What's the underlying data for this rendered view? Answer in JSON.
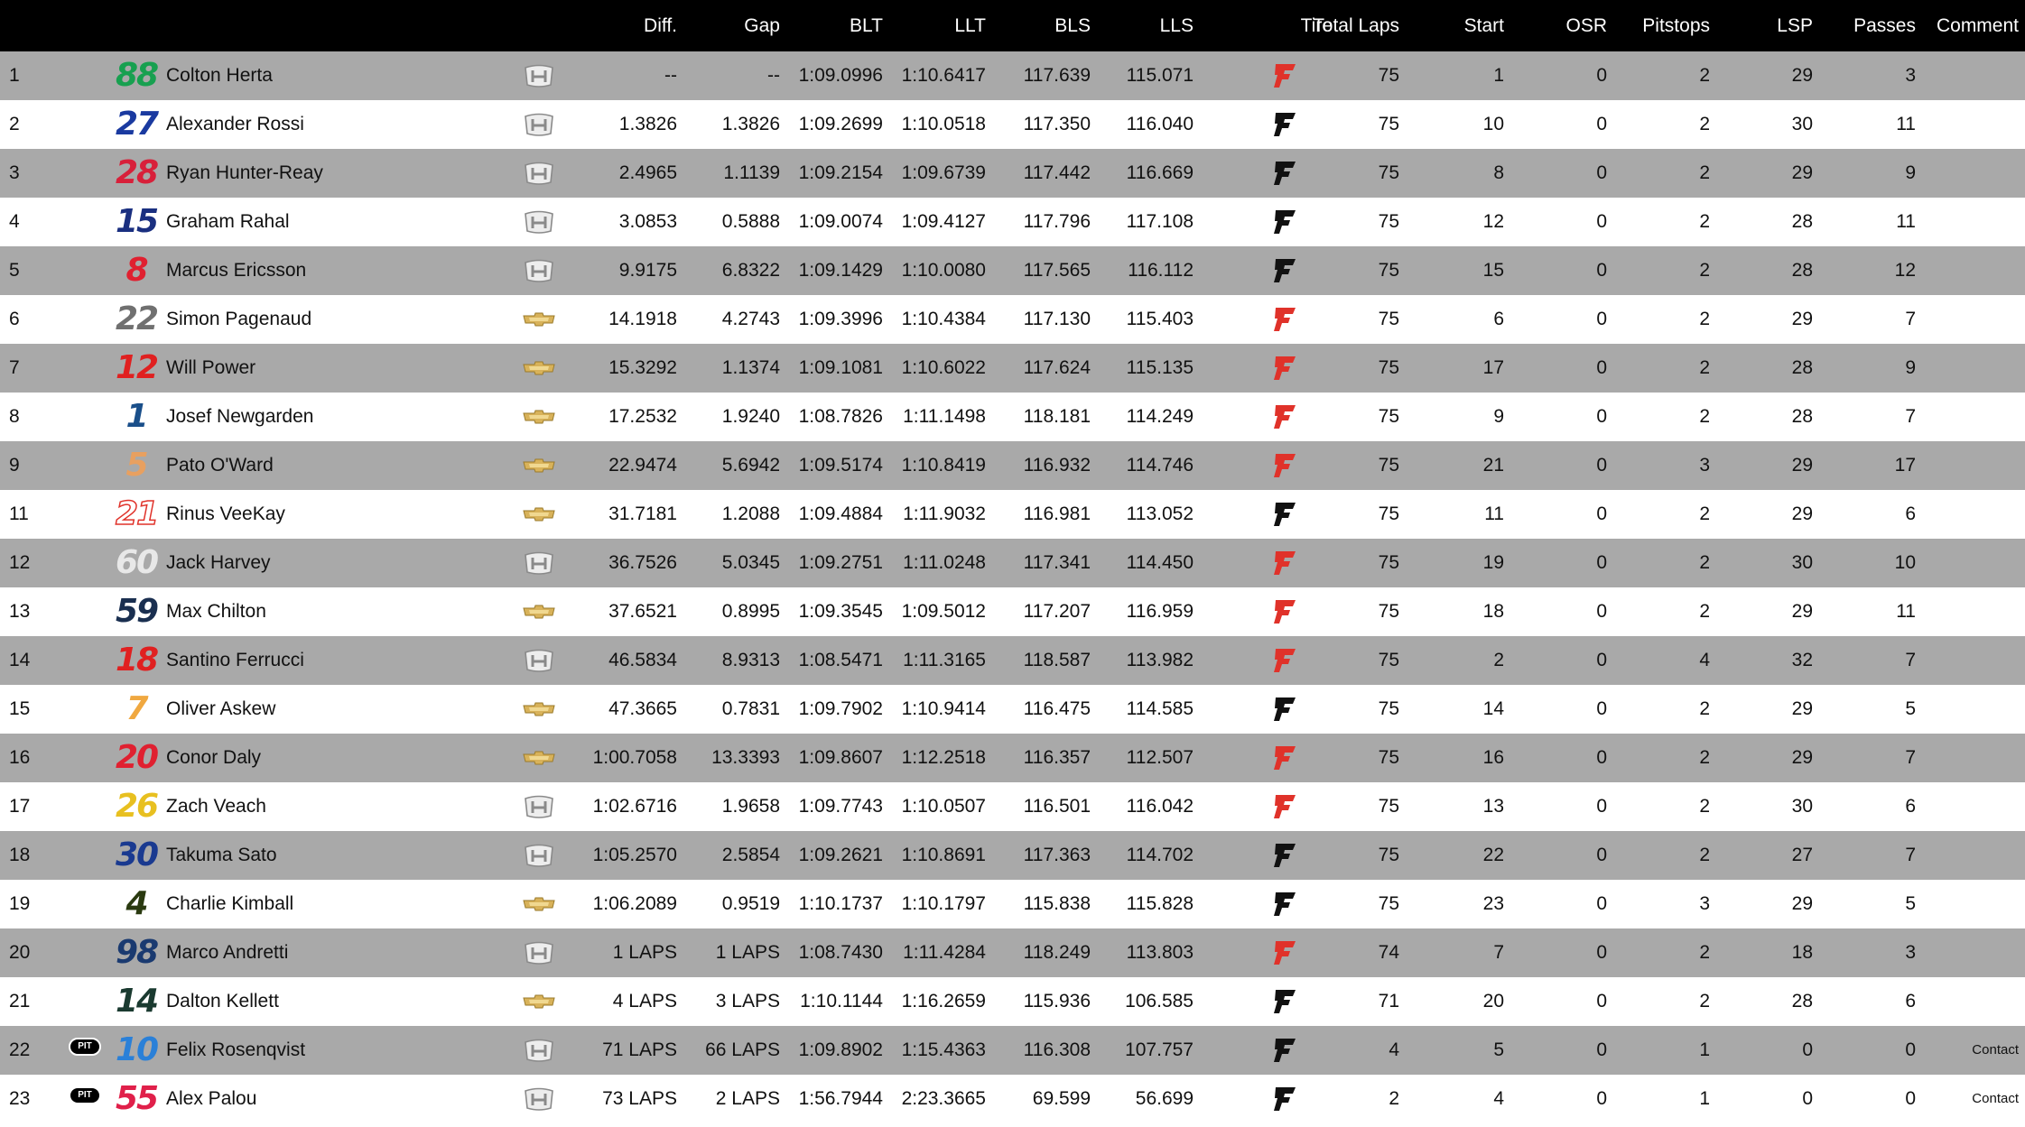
{
  "columns": {
    "diff": "Diff.",
    "gap": "Gap",
    "blt": "BLT",
    "llt": "LLT",
    "bls": "BLS",
    "lls": "LLS",
    "tire": "Tire",
    "total_laps": "Total Laps",
    "start": "Start",
    "osr": "OSR",
    "pitstops": "Pitstops",
    "lsp": "LSP",
    "passes": "Passes",
    "comment": "Comment"
  },
  "colors": {
    "header_bg": "#000000",
    "row_gray": "#a9a9a9",
    "row_white": "#ffffff",
    "tire_red": "#e0322a",
    "tire_black": "#111111"
  },
  "rows": [
    {
      "pos": "1",
      "pit": "",
      "num": "88",
      "num_color": "#18a050",
      "num_style": "solid",
      "name": "Colton Herta",
      "engine": "honda",
      "diff": "--",
      "gap": "--",
      "blt": "1:09.0996",
      "llt": "1:10.6417",
      "bls": "117.639",
      "lls": "115.071",
      "tire": "red",
      "laps": "75",
      "start": "1",
      "osr": "0",
      "pits": "2",
      "lsp": "29",
      "passes": "3",
      "comment": ""
    },
    {
      "pos": "2",
      "pit": "",
      "num": "27",
      "num_color": "#1a3aa0",
      "num_style": "solid",
      "name": "Alexander Rossi",
      "engine": "honda",
      "diff": "1.3826",
      "gap": "1.3826",
      "blt": "1:09.2699",
      "llt": "1:10.0518",
      "bls": "117.350",
      "lls": "116.040",
      "tire": "black",
      "laps": "75",
      "start": "10",
      "osr": "0",
      "pits": "2",
      "lsp": "30",
      "passes": "11",
      "comment": ""
    },
    {
      "pos": "3",
      "pit": "",
      "num": "28",
      "num_color": "#d8203a",
      "num_style": "solid",
      "name": "Ryan Hunter-Reay",
      "engine": "honda",
      "diff": "2.4965",
      "gap": "1.1139",
      "blt": "1:09.2154",
      "llt": "1:09.6739",
      "bls": "117.442",
      "lls": "116.669",
      "tire": "black",
      "laps": "75",
      "start": "8",
      "osr": "0",
      "pits": "2",
      "lsp": "29",
      "passes": "9",
      "comment": ""
    },
    {
      "pos": "4",
      "pit": "",
      "num": "15",
      "num_color": "#1a2f80",
      "num_style": "solid",
      "name": "Graham Rahal",
      "engine": "honda",
      "diff": "3.0853",
      "gap": "0.5888",
      "blt": "1:09.0074",
      "llt": "1:09.4127",
      "bls": "117.796",
      "lls": "117.108",
      "tire": "black",
      "laps": "75",
      "start": "12",
      "osr": "0",
      "pits": "2",
      "lsp": "28",
      "passes": "11",
      "comment": ""
    },
    {
      "pos": "5",
      "pit": "",
      "num": "8",
      "num_color": "#e02030",
      "num_style": "solid",
      "name": "Marcus Ericsson",
      "engine": "honda",
      "diff": "9.9175",
      "gap": "6.8322",
      "blt": "1:09.1429",
      "llt": "1:10.0080",
      "bls": "117.565",
      "lls": "116.112",
      "tire": "black",
      "laps": "75",
      "start": "15",
      "osr": "0",
      "pits": "2",
      "lsp": "28",
      "passes": "12",
      "comment": ""
    },
    {
      "pos": "6",
      "pit": "",
      "num": "22",
      "num_color": "#707070",
      "num_style": "solid",
      "name": "Simon Pagenaud",
      "engine": "chevrolet",
      "diff": "14.1918",
      "gap": "4.2743",
      "blt": "1:09.3996",
      "llt": "1:10.4384",
      "bls": "117.130",
      "lls": "115.403",
      "tire": "red",
      "laps": "75",
      "start": "6",
      "osr": "0",
      "pits": "2",
      "lsp": "29",
      "passes": "7",
      "comment": ""
    },
    {
      "pos": "7",
      "pit": "",
      "num": "12",
      "num_color": "#e02020",
      "num_style": "solid",
      "name": "Will Power",
      "engine": "chevrolet",
      "diff": "15.3292",
      "gap": "1.1374",
      "blt": "1:09.1081",
      "llt": "1:10.6022",
      "bls": "117.624",
      "lls": "115.135",
      "tire": "red",
      "laps": "75",
      "start": "17",
      "osr": "0",
      "pits": "2",
      "lsp": "28",
      "passes": "9",
      "comment": ""
    },
    {
      "pos": "8",
      "pit": "",
      "num": "1",
      "num_color": "#1a4f8a",
      "num_style": "solid",
      "name": "Josef Newgarden",
      "engine": "chevrolet",
      "diff": "17.2532",
      "gap": "1.9240",
      "blt": "1:08.7826",
      "llt": "1:11.1498",
      "bls": "118.181",
      "lls": "114.249",
      "tire": "red",
      "laps": "75",
      "start": "9",
      "osr": "0",
      "pits": "2",
      "lsp": "28",
      "passes": "7",
      "comment": ""
    },
    {
      "pos": "9",
      "pit": "",
      "num": "5",
      "num_color": "#e8a060",
      "num_style": "solid",
      "name": "Pato O'Ward",
      "engine": "chevrolet",
      "diff": "22.9474",
      "gap": "5.6942",
      "blt": "1:09.5174",
      "llt": "1:10.8419",
      "bls": "116.932",
      "lls": "114.746",
      "tire": "red",
      "laps": "75",
      "start": "21",
      "osr": "0",
      "pits": "3",
      "lsp": "29",
      "passes": "17",
      "comment": ""
    },
    {
      "pos": "11",
      "pit": "",
      "num": "21",
      "num_color": "#ffffff",
      "num_style": "outline",
      "name": "Rinus VeeKay",
      "engine": "chevrolet",
      "diff": "31.7181",
      "gap": "1.2088",
      "blt": "1:09.4884",
      "llt": "1:11.9032",
      "bls": "116.981",
      "lls": "113.052",
      "tire": "black",
      "laps": "75",
      "start": "11",
      "osr": "0",
      "pits": "2",
      "lsp": "29",
      "passes": "6",
      "comment": ""
    },
    {
      "pos": "12",
      "pit": "",
      "num": "60",
      "num_color": "#e8e8e8",
      "num_style": "solid",
      "name": "Jack Harvey",
      "engine": "honda",
      "diff": "36.7526",
      "gap": "5.0345",
      "blt": "1:09.2751",
      "llt": "1:11.0248",
      "bls": "117.341",
      "lls": "114.450",
      "tire": "red",
      "laps": "75",
      "start": "19",
      "osr": "0",
      "pits": "2",
      "lsp": "30",
      "passes": "10",
      "comment": ""
    },
    {
      "pos": "13",
      "pit": "",
      "num": "59",
      "num_color": "#1a2f50",
      "num_style": "solid",
      "name": "Max Chilton",
      "engine": "chevrolet",
      "diff": "37.6521",
      "gap": "0.8995",
      "blt": "1:09.3545",
      "llt": "1:09.5012",
      "bls": "117.207",
      "lls": "116.959",
      "tire": "red",
      "laps": "75",
      "start": "18",
      "osr": "0",
      "pits": "2",
      "lsp": "29",
      "passes": "11",
      "comment": ""
    },
    {
      "pos": "14",
      "pit": "",
      "num": "18",
      "num_color": "#e02020",
      "num_style": "solid",
      "name": "Santino Ferrucci",
      "engine": "honda",
      "diff": "46.5834",
      "gap": "8.9313",
      "blt": "1:08.5471",
      "llt": "1:11.3165",
      "bls": "118.587",
      "lls": "113.982",
      "tire": "red",
      "laps": "75",
      "start": "2",
      "osr": "0",
      "pits": "4",
      "lsp": "32",
      "passes": "7",
      "comment": ""
    },
    {
      "pos": "15",
      "pit": "",
      "num": "7",
      "num_color": "#f0a840",
      "num_style": "solid",
      "name": "Oliver Askew",
      "engine": "chevrolet",
      "diff": "47.3665",
      "gap": "0.7831",
      "blt": "1:09.7902",
      "llt": "1:10.9414",
      "bls": "116.475",
      "lls": "114.585",
      "tire": "black",
      "laps": "75",
      "start": "14",
      "osr": "0",
      "pits": "2",
      "lsp": "29",
      "passes": "5",
      "comment": ""
    },
    {
      "pos": "16",
      "pit": "",
      "num": "20",
      "num_color": "#e02030",
      "num_style": "solid",
      "name": "Conor Daly",
      "engine": "chevrolet",
      "diff": "1:00.7058",
      "gap": "13.3393",
      "blt": "1:09.8607",
      "llt": "1:12.2518",
      "bls": "116.357",
      "lls": "112.507",
      "tire": "red",
      "laps": "75",
      "start": "16",
      "osr": "0",
      "pits": "2",
      "lsp": "29",
      "passes": "7",
      "comment": ""
    },
    {
      "pos": "17",
      "pit": "",
      "num": "26",
      "num_color": "#e8c020",
      "num_style": "solid",
      "name": "Zach Veach",
      "engine": "honda",
      "diff": "1:02.6716",
      "gap": "1.9658",
      "blt": "1:09.7743",
      "llt": "1:10.0507",
      "bls": "116.501",
      "lls": "116.042",
      "tire": "red",
      "laps": "75",
      "start": "13",
      "osr": "0",
      "pits": "2",
      "lsp": "30",
      "passes": "6",
      "comment": ""
    },
    {
      "pos": "18",
      "pit": "",
      "num": "30",
      "num_color": "#1a3a90",
      "num_style": "solid",
      "name": "Takuma Sato",
      "engine": "honda",
      "diff": "1:05.2570",
      "gap": "2.5854",
      "blt": "1:09.2621",
      "llt": "1:10.8691",
      "bls": "117.363",
      "lls": "114.702",
      "tire": "black",
      "laps": "75",
      "start": "22",
      "osr": "0",
      "pits": "2",
      "lsp": "27",
      "passes": "7",
      "comment": ""
    },
    {
      "pos": "19",
      "pit": "",
      "num": "4",
      "num_color": "#2a3a10",
      "num_style": "solid",
      "name": "Charlie Kimball",
      "engine": "chevrolet",
      "diff": "1:06.2089",
      "gap": "0.9519",
      "blt": "1:10.1737",
      "llt": "1:10.1797",
      "bls": "115.838",
      "lls": "115.828",
      "tire": "black",
      "laps": "75",
      "start": "23",
      "osr": "0",
      "pits": "3",
      "lsp": "29",
      "passes": "5",
      "comment": ""
    },
    {
      "pos": "20",
      "pit": "",
      "num": "98",
      "num_color": "#1a3a70",
      "num_style": "solid",
      "name": "Marco Andretti",
      "engine": "honda",
      "diff": "1 LAPS",
      "gap": "1 LAPS",
      "blt": "1:08.7430",
      "llt": "1:11.4284",
      "bls": "118.249",
      "lls": "113.803",
      "tire": "red",
      "laps": "74",
      "start": "7",
      "osr": "0",
      "pits": "2",
      "lsp": "18",
      "passes": "3",
      "comment": ""
    },
    {
      "pos": "21",
      "pit": "",
      "num": "14",
      "num_color": "#1a3a30",
      "num_style": "solid",
      "name": "Dalton Kellett",
      "engine": "chevrolet",
      "diff": "4 LAPS",
      "gap": "3 LAPS",
      "blt": "1:10.1144",
      "llt": "1:16.2659",
      "bls": "115.936",
      "lls": "106.585",
      "tire": "black",
      "laps": "71",
      "start": "20",
      "osr": "0",
      "pits": "2",
      "lsp": "28",
      "passes": "6",
      "comment": ""
    },
    {
      "pos": "22",
      "pit": "PIT",
      "num": "10",
      "num_color": "#2a80d8",
      "num_style": "solid",
      "name": "Felix Rosenqvist",
      "engine": "honda",
      "diff": "71 LAPS",
      "gap": "66 LAPS",
      "blt": "1:09.8902",
      "llt": "1:15.4363",
      "bls": "116.308",
      "lls": "107.757",
      "tire": "black",
      "laps": "4",
      "start": "5",
      "osr": "0",
      "pits": "1",
      "lsp": "0",
      "passes": "0",
      "comment": "Contact"
    },
    {
      "pos": "23",
      "pit": "PIT",
      "num": "55",
      "num_color": "#e0204a",
      "num_style": "solid",
      "name": "Alex Palou",
      "engine": "honda",
      "diff": "73 LAPS",
      "gap": "2 LAPS",
      "blt": "1:56.7944",
      "llt": "2:23.3665",
      "bls": "69.599",
      "lls": "56.699",
      "tire": "black",
      "laps": "2",
      "start": "4",
      "osr": "0",
      "pits": "1",
      "lsp": "0",
      "passes": "0",
      "comment": "Contact"
    }
  ]
}
